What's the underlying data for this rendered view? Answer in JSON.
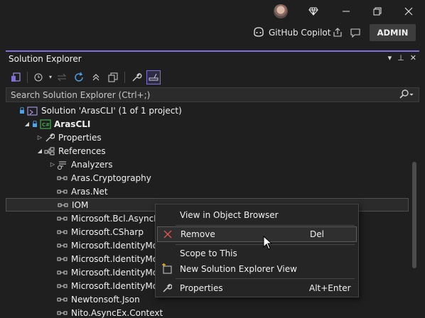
{
  "titlebar": {
    "copilot_label": "GitHub Copilot",
    "admin_label": "ADMIN"
  },
  "panel": {
    "title": "Solution Explorer",
    "search_placeholder": "Search Solution Explorer (Ctrl+;)"
  },
  "tree": [
    {
      "label": "Solution 'ArasCLI' (1 of 1 project)",
      "icon": "solution-icon",
      "indent": 0,
      "expander": "",
      "bold": false
    },
    {
      "label": "ArasCLI",
      "icon": "csharp-project-icon",
      "indent": 1,
      "expander": "expanded",
      "bold": true
    },
    {
      "label": "Properties",
      "icon": "wrench-icon",
      "indent": 2,
      "expander": "collapsed",
      "bold": false
    },
    {
      "label": "References",
      "icon": "references-icon",
      "indent": 2,
      "expander": "expanded",
      "bold": false
    },
    {
      "label": "Analyzers",
      "icon": "analyzers-icon",
      "indent": 3,
      "expander": "collapsed",
      "bold": false
    },
    {
      "label": "Aras.Cryptography",
      "icon": "reference-icon",
      "indent": 3,
      "expander": "",
      "bold": false
    },
    {
      "label": "Aras.Net",
      "icon": "reference-icon",
      "indent": 3,
      "expander": "",
      "bold": false
    },
    {
      "label": "IOM",
      "icon": "reference-icon",
      "indent": 3,
      "expander": "",
      "bold": false,
      "selected": true
    },
    {
      "label": "Microsoft.Bcl.AsyncInt",
      "icon": "reference-icon",
      "indent": 3,
      "expander": "",
      "bold": false
    },
    {
      "label": "Microsoft.CSharp",
      "icon": "reference-icon",
      "indent": 3,
      "expander": "",
      "bold": false
    },
    {
      "label": "Microsoft.IdentityMod",
      "icon": "reference-icon",
      "indent": 3,
      "expander": "",
      "bold": false
    },
    {
      "label": "Microsoft.IdentityMod",
      "icon": "reference-icon",
      "indent": 3,
      "expander": "",
      "bold": false
    },
    {
      "label": "Microsoft.IdentityMod",
      "icon": "reference-icon",
      "indent": 3,
      "expander": "",
      "bold": false
    },
    {
      "label": "Microsoft.IdentityMod",
      "icon": "reference-icon",
      "indent": 3,
      "expander": "",
      "bold": false
    },
    {
      "label": "Newtonsoft.Json",
      "icon": "reference-icon",
      "indent": 3,
      "expander": "",
      "bold": false
    },
    {
      "label": "Nito.AsyncEx.Context",
      "icon": "reference-icon",
      "indent": 3,
      "expander": "",
      "bold": false
    }
  ],
  "context_menu": {
    "items": [
      {
        "label": "View in Object Browser",
        "shortcut": "",
        "icon": ""
      },
      {
        "label": "Remove",
        "shortcut": "Del",
        "icon": "remove-icon"
      },
      {
        "label": "Scope to This",
        "shortcut": "",
        "icon": ""
      },
      {
        "label": "New Solution Explorer View",
        "shortcut": "",
        "icon": "new-view-icon"
      },
      {
        "label": "Properties",
        "shortcut": "Alt+Enter",
        "icon": "wrench-icon"
      }
    ]
  },
  "colors": {
    "accent": "#7f6fd8",
    "remove_icon": "#e05555",
    "csharp_badge": "#3fa34d"
  }
}
